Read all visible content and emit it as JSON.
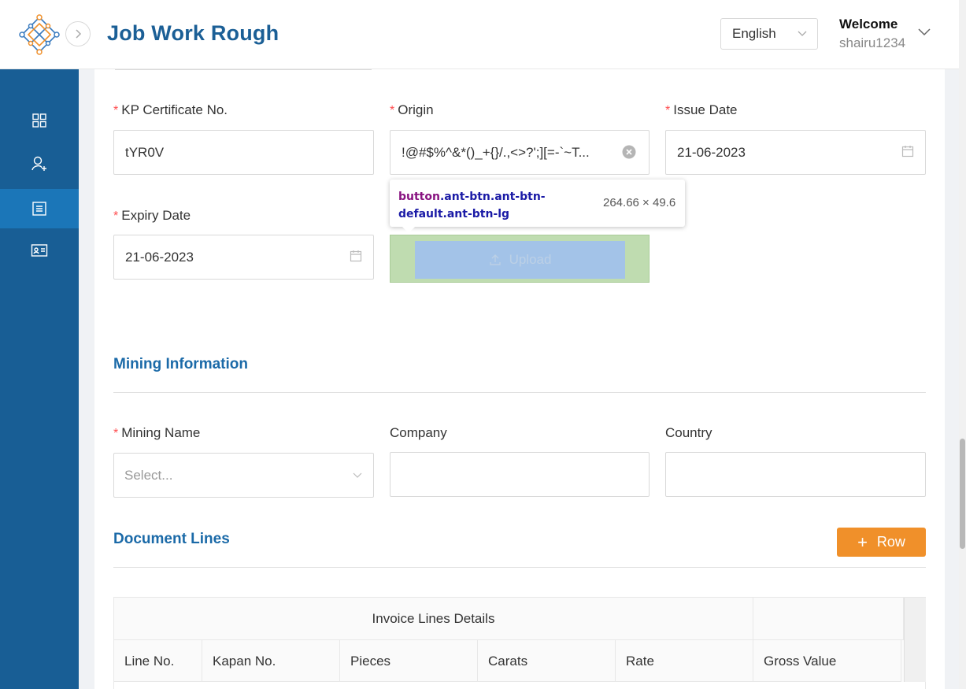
{
  "header": {
    "title": "Job Work Rough",
    "language": "English",
    "welcome": "Welcome",
    "username": "shairu1234"
  },
  "sidebar": {
    "items": [
      {
        "icon": "dashboard-grid-icon",
        "active": false
      },
      {
        "icon": "user-add-icon",
        "active": false
      },
      {
        "icon": "list-document-icon",
        "active": true
      },
      {
        "icon": "id-card-icon",
        "active": false
      }
    ]
  },
  "form": {
    "kp_certificate": {
      "label": "KP Certificate No.",
      "value": "tYR0V"
    },
    "origin": {
      "label": "Origin",
      "value": "!@#$%^&*()_+{}/.,<>?';][=-`~T..."
    },
    "issue_date": {
      "label": "Issue Date",
      "value": "21-06-2023"
    },
    "expiry_date": {
      "label": "Expiry Date",
      "value": "21-06-2023"
    },
    "upload_label": "Upload"
  },
  "tooltip": {
    "selector_tag": "button",
    "selector_classes": ".ant-btn.ant-btn-default.ant-btn-lg",
    "size": "264.66 × 49.6"
  },
  "mining": {
    "title": "Mining Information",
    "mining_name": {
      "label": "Mining Name",
      "placeholder": "Select..."
    },
    "company": {
      "label": "Company",
      "value": ""
    },
    "country": {
      "label": "Country",
      "value": ""
    }
  },
  "document_lines": {
    "title": "Document Lines",
    "add_row_label": "Row",
    "table": {
      "group_header": "Invoice Lines Details",
      "columns": [
        "Line No.",
        "Kapan No.",
        "Pieces",
        "Carats",
        "Rate",
        "Gross Value"
      ]
    }
  },
  "colors": {
    "brand": "#1b5f96",
    "sidebar": "#185e95",
    "sidebar_active": "#1b76b8",
    "accent_orange": "#f0902a",
    "required": "#ff4d4f"
  }
}
